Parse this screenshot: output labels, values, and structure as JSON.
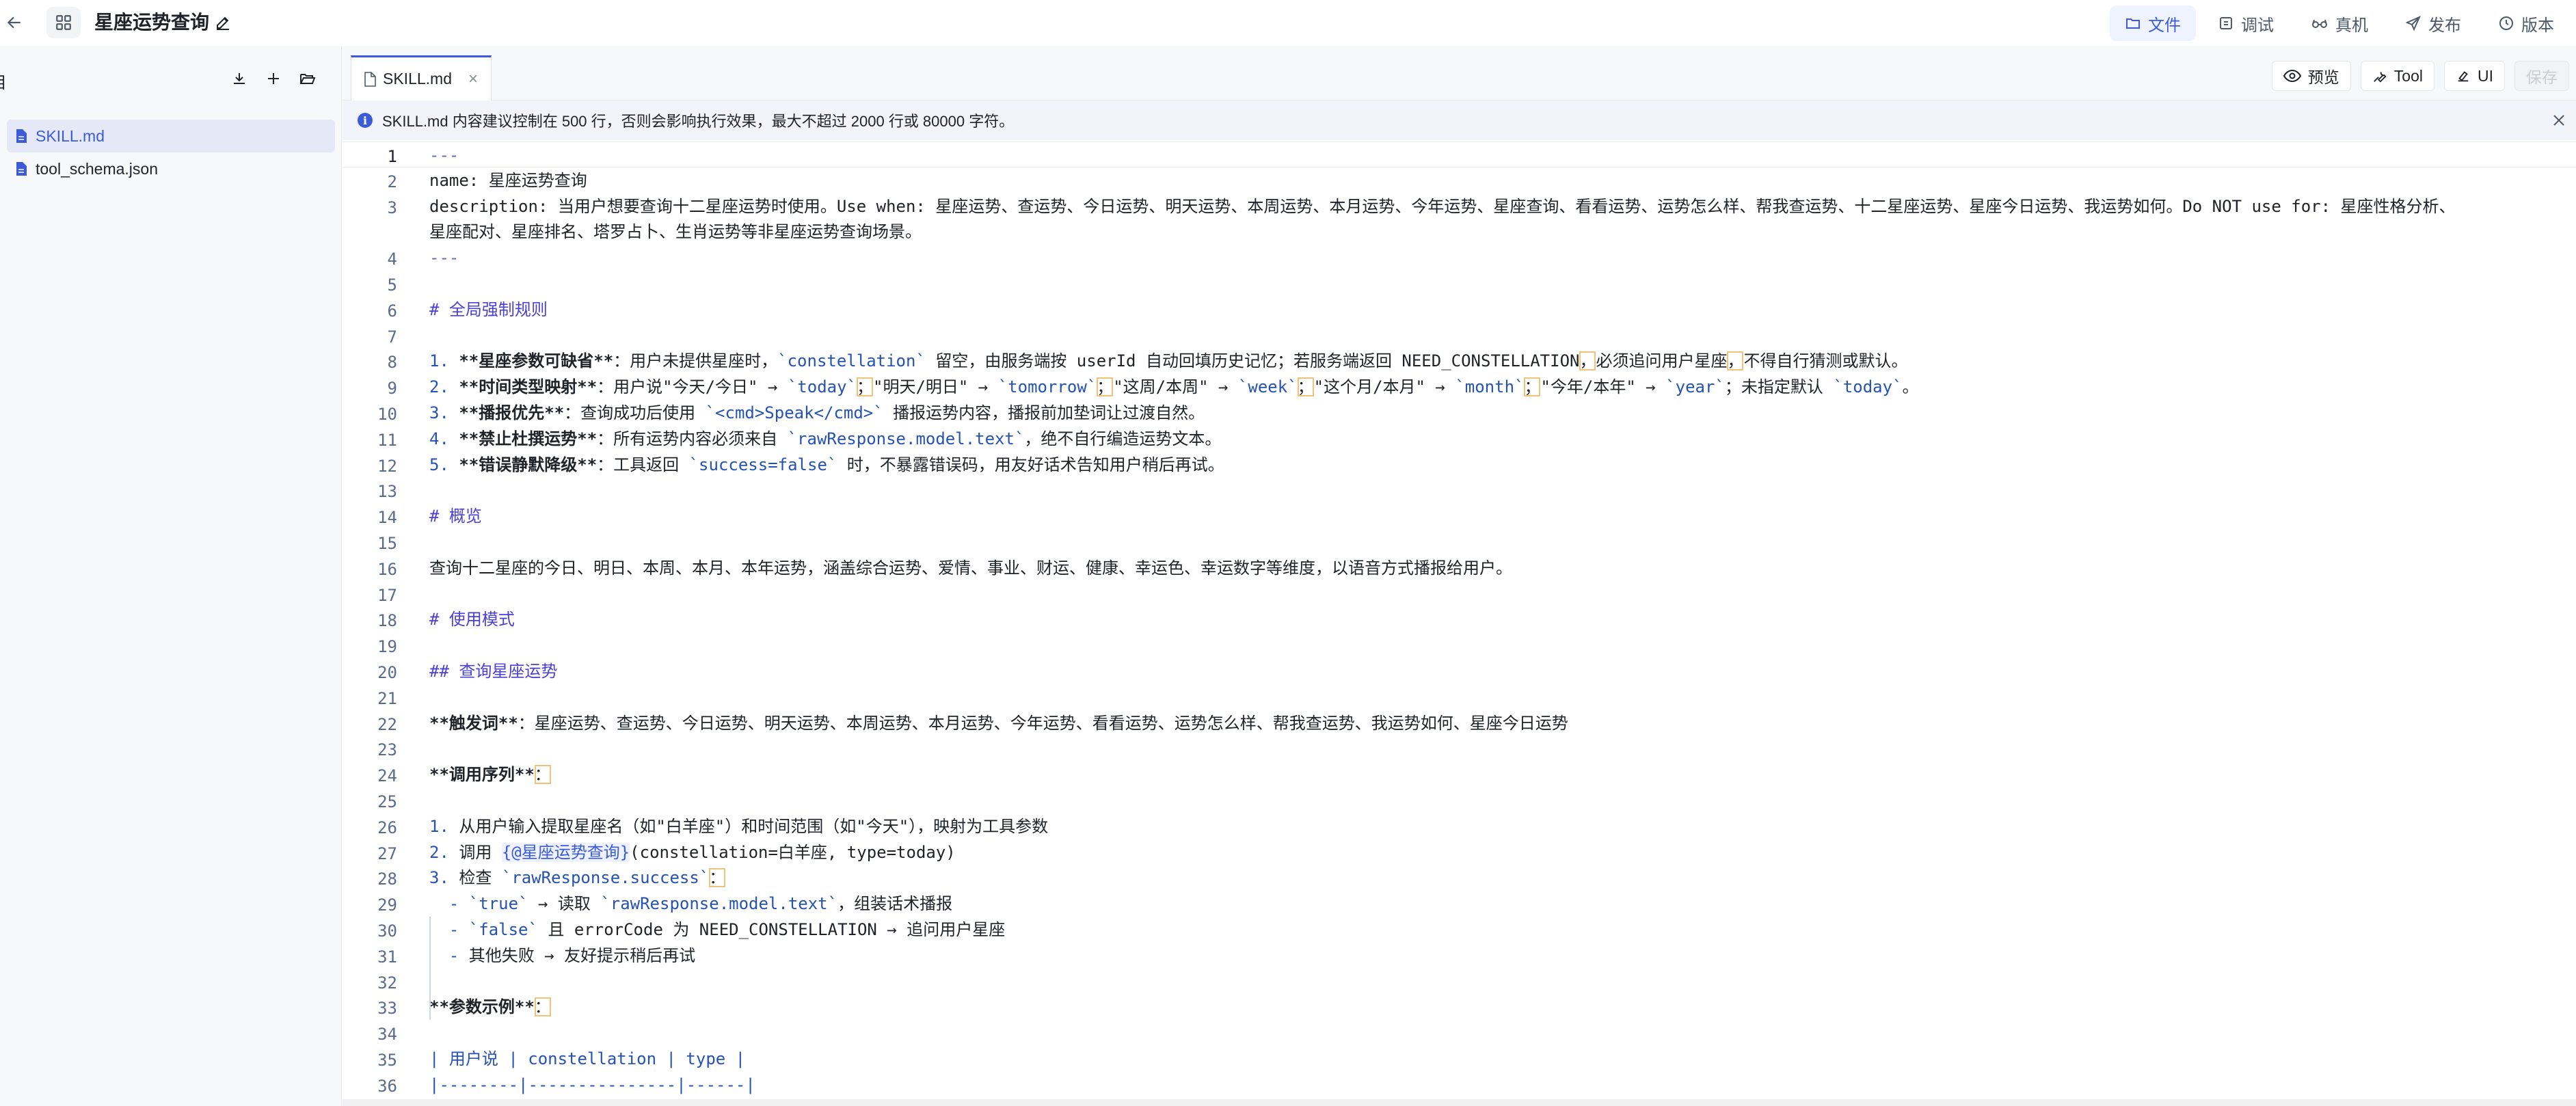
{
  "header": {
    "title": "星座运势查询",
    "tabs": [
      {
        "label": "文件",
        "icon": "folder-icon",
        "active": true
      },
      {
        "label": "调试",
        "icon": "debug-icon",
        "active": false
      },
      {
        "label": "真机",
        "icon": "glasses-icon",
        "active": false
      },
      {
        "label": "发布",
        "icon": "send-icon",
        "active": false
      },
      {
        "label": "版本",
        "icon": "history-icon",
        "active": false
      }
    ]
  },
  "sidebar": {
    "title": "目",
    "files": [
      {
        "name": "SKILL.md",
        "selected": true
      },
      {
        "name": "tool_schema.json",
        "selected": false
      }
    ]
  },
  "editor": {
    "tab_label": "SKILL.md",
    "buttons": {
      "preview": "预览",
      "tool": "Tool",
      "ui": "UI",
      "save": "保存"
    },
    "notice": "SKILL.md 内容建议控制在 500 行，否则会影响执行效果，最大不超过 2000 行或 80000 字符。",
    "lines": [
      {
        "n": "1",
        "segs": [
          {
            "t": "---",
            "c": "c-dash"
          }
        ]
      },
      {
        "n": "2",
        "segs": [
          {
            "t": "name: 星座运势查询"
          }
        ]
      },
      {
        "n": "3",
        "segs": [
          {
            "t": "description: 当用户想要查询十二星座运势时使用。Use when: 星座运势、查运势、今日运势、明天运势、本周运势、本月运势、今年运势、星座查询、看看运势、运势怎么样、帮我查运势、十二星座运势、星座今日运势、我运势如何。Do NOT use for: 星座性格分析、"
          }
        ]
      },
      {
        "n": "",
        "segs": [
          {
            "t": "星座配对、星座排名、塔罗占卜、生肖运势等非星座运势查询场景。"
          }
        ]
      },
      {
        "n": "4",
        "segs": [
          {
            "t": "---",
            "c": "c-dash"
          }
        ]
      },
      {
        "n": "5",
        "segs": []
      },
      {
        "n": "6",
        "segs": [
          {
            "t": "# 全局强制规则",
            "c": "c-h"
          }
        ]
      },
      {
        "n": "7",
        "segs": []
      },
      {
        "n": "8",
        "segs": [
          {
            "t": "1. ",
            "c": "c-list"
          },
          {
            "t": "**星座参数可缺省**",
            "c": "c-bold"
          },
          {
            "t": "：用户未提供星座时，"
          },
          {
            "t": "`constellation`",
            "c": "c-code"
          },
          {
            "t": " 留空，由服务端按 userId 自动回填历史记忆；若服务端返回 NEED_CONSTELLATION"
          },
          {
            "t": "，",
            "c": "c-box"
          },
          {
            "t": "必须追问用户星座"
          },
          {
            "t": "，",
            "c": "c-box"
          },
          {
            "t": "不得自行猜测或默认。"
          }
        ]
      },
      {
        "n": "9",
        "segs": [
          {
            "t": "2. ",
            "c": "c-list"
          },
          {
            "t": "**时间类型映射**",
            "c": "c-bold"
          },
          {
            "t": "：用户说\"今天/今日\" → "
          },
          {
            "t": "`today`",
            "c": "c-code"
          },
          {
            "t": "；",
            "c": "c-box"
          },
          {
            "t": "\"明天/明日\" → "
          },
          {
            "t": "`tomorrow`",
            "c": "c-code"
          },
          {
            "t": "；",
            "c": "c-box"
          },
          {
            "t": "\"这周/本周\" → "
          },
          {
            "t": "`week`",
            "c": "c-code"
          },
          {
            "t": "；",
            "c": "c-box"
          },
          {
            "t": "\"这个月/本月\" → "
          },
          {
            "t": "`month`",
            "c": "c-code"
          },
          {
            "t": "；",
            "c": "c-box"
          },
          {
            "t": "\"今年/本年\" → "
          },
          {
            "t": "`year`",
            "c": "c-code"
          },
          {
            "t": "；未指定默认 "
          },
          {
            "t": "`today`",
            "c": "c-code"
          },
          {
            "t": "。"
          }
        ]
      },
      {
        "n": "10",
        "segs": [
          {
            "t": "3. ",
            "c": "c-list"
          },
          {
            "t": "**播报优先**",
            "c": "c-bold"
          },
          {
            "t": "：查询成功后使用 "
          },
          {
            "t": "`<cmd>Speak</cmd>`",
            "c": "c-code"
          },
          {
            "t": " 播报运势内容，播报前加垫词让过渡自然。"
          }
        ]
      },
      {
        "n": "11",
        "segs": [
          {
            "t": "4. ",
            "c": "c-list"
          },
          {
            "t": "**禁止杜撰运势**",
            "c": "c-bold"
          },
          {
            "t": "：所有运势内容必须来自 "
          },
          {
            "t": "`rawResponse.model.text`",
            "c": "c-code"
          },
          {
            "t": "，绝不自行编造运势文本。"
          }
        ]
      },
      {
        "n": "12",
        "segs": [
          {
            "t": "5. ",
            "c": "c-list"
          },
          {
            "t": "**错误静默降级**",
            "c": "c-bold"
          },
          {
            "t": "：工具返回 "
          },
          {
            "t": "`success=false`",
            "c": "c-code"
          },
          {
            "t": " 时，不暴露错误码，用友好话术告知用户稍后再试。"
          }
        ]
      },
      {
        "n": "13",
        "segs": []
      },
      {
        "n": "14",
        "segs": [
          {
            "t": "# 概览",
            "c": "c-h"
          }
        ]
      },
      {
        "n": "15",
        "segs": []
      },
      {
        "n": "16",
        "segs": [
          {
            "t": "查询十二星座的今日、明日、本周、本月、本年运势，涵盖综合运势、爱情、事业、财运、健康、幸运色、幸运数字等维度，以语音方式播报给用户。"
          }
        ]
      },
      {
        "n": "17",
        "segs": []
      },
      {
        "n": "18",
        "segs": [
          {
            "t": "# 使用模式",
            "c": "c-h"
          }
        ]
      },
      {
        "n": "19",
        "segs": []
      },
      {
        "n": "20",
        "segs": [
          {
            "t": "## 查询星座运势",
            "c": "c-h"
          }
        ]
      },
      {
        "n": "21",
        "segs": []
      },
      {
        "n": "22",
        "segs": [
          {
            "t": "**触发词**",
            "c": "c-bold"
          },
          {
            "t": "：星座运势、查运势、今日运势、明天运势、本周运势、本月运势、今年运势、看看运势、运势怎么样、帮我查运势、我运势如何、星座今日运势"
          }
        ]
      },
      {
        "n": "23",
        "segs": []
      },
      {
        "n": "24",
        "segs": [
          {
            "t": "**调用序列**",
            "c": "c-bold"
          },
          {
            "t": "：",
            "c": "c-box"
          }
        ]
      },
      {
        "n": "25",
        "segs": []
      },
      {
        "n": "26",
        "segs": [
          {
            "t": "1. ",
            "c": "c-list"
          },
          {
            "t": "从用户输入提取星座名（如\"白羊座\"）和时间范围（如\"今天\"），映射为工具参数"
          }
        ]
      },
      {
        "n": "27",
        "segs": [
          {
            "t": "2. ",
            "c": "c-list"
          },
          {
            "t": "调用 "
          },
          {
            "t": "{@星座运势查询}",
            "c": "c-ref"
          },
          {
            "t": "(constellation=白羊座, type=today)"
          }
        ]
      },
      {
        "n": "28",
        "segs": [
          {
            "t": "3. ",
            "c": "c-list"
          },
          {
            "t": "检查 "
          },
          {
            "t": "`rawResponse.success`",
            "c": "c-code"
          },
          {
            "t": "：",
            "c": "c-box"
          }
        ]
      },
      {
        "n": "29",
        "segs": [
          {
            "t": "  - ",
            "c": "c-list"
          },
          {
            "t": "`true`",
            "c": "c-code"
          },
          {
            "t": " → 读取 "
          },
          {
            "t": "`rawResponse.model.text`",
            "c": "c-code"
          },
          {
            "t": "，组装话术播报"
          }
        ]
      },
      {
        "n": "30",
        "segs": [
          {
            "t": "  - ",
            "c": "c-list"
          },
          {
            "t": "`false`",
            "c": "c-code"
          },
          {
            "t": " 且 errorCode 为 NEED_CONSTELLATION → 追问用户星座"
          }
        ]
      },
      {
        "n": "31",
        "segs": [
          {
            "t": "  - ",
            "c": "c-list"
          },
          {
            "t": "其他失败 → 友好提示稍后再试"
          }
        ]
      },
      {
        "n": "32",
        "segs": []
      },
      {
        "n": "33",
        "segs": [
          {
            "t": "**参数示例**",
            "c": "c-bold"
          },
          {
            "t": "：",
            "c": "c-box"
          }
        ]
      },
      {
        "n": "34",
        "segs": []
      },
      {
        "n": "35",
        "segs": [
          {
            "t": "| 用户说 | constellation | type |",
            "c": "c-list"
          }
        ]
      },
      {
        "n": "36",
        "segs": [
          {
            "t": "|--------|---------------|------|",
            "c": "c-list"
          }
        ]
      }
    ]
  }
}
